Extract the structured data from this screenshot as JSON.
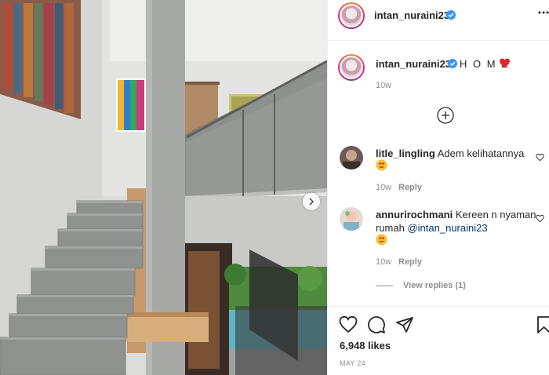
{
  "post": {
    "username": "intan_nuraini23",
    "caption": "H O M E",
    "caption_time": "10w",
    "load_more_icon": "plus-circle-icon",
    "more_icon": "more-options-icon"
  },
  "comments": [
    {
      "username": "litle_lingling",
      "text": "Adem kelihatannya",
      "emoji": "heart-eyes-emoji",
      "time": "10w",
      "reply_label": "Reply"
    },
    {
      "username": "annurirochmani",
      "text": "Kereen n nyaman rumah ",
      "mention": "@intan_nuraini23",
      "emoji": "heart-eyes-emoji",
      "time": "10w",
      "reply_label": "Reply",
      "view_replies": "View replies (1)"
    }
  ],
  "footer": {
    "likes": "6,948 likes",
    "date": "MAY 24"
  },
  "colors": {
    "accent_verified": "#3897f0",
    "heart": "#ed4956",
    "muted": "#8e8e8e",
    "mention": "#00376b"
  }
}
